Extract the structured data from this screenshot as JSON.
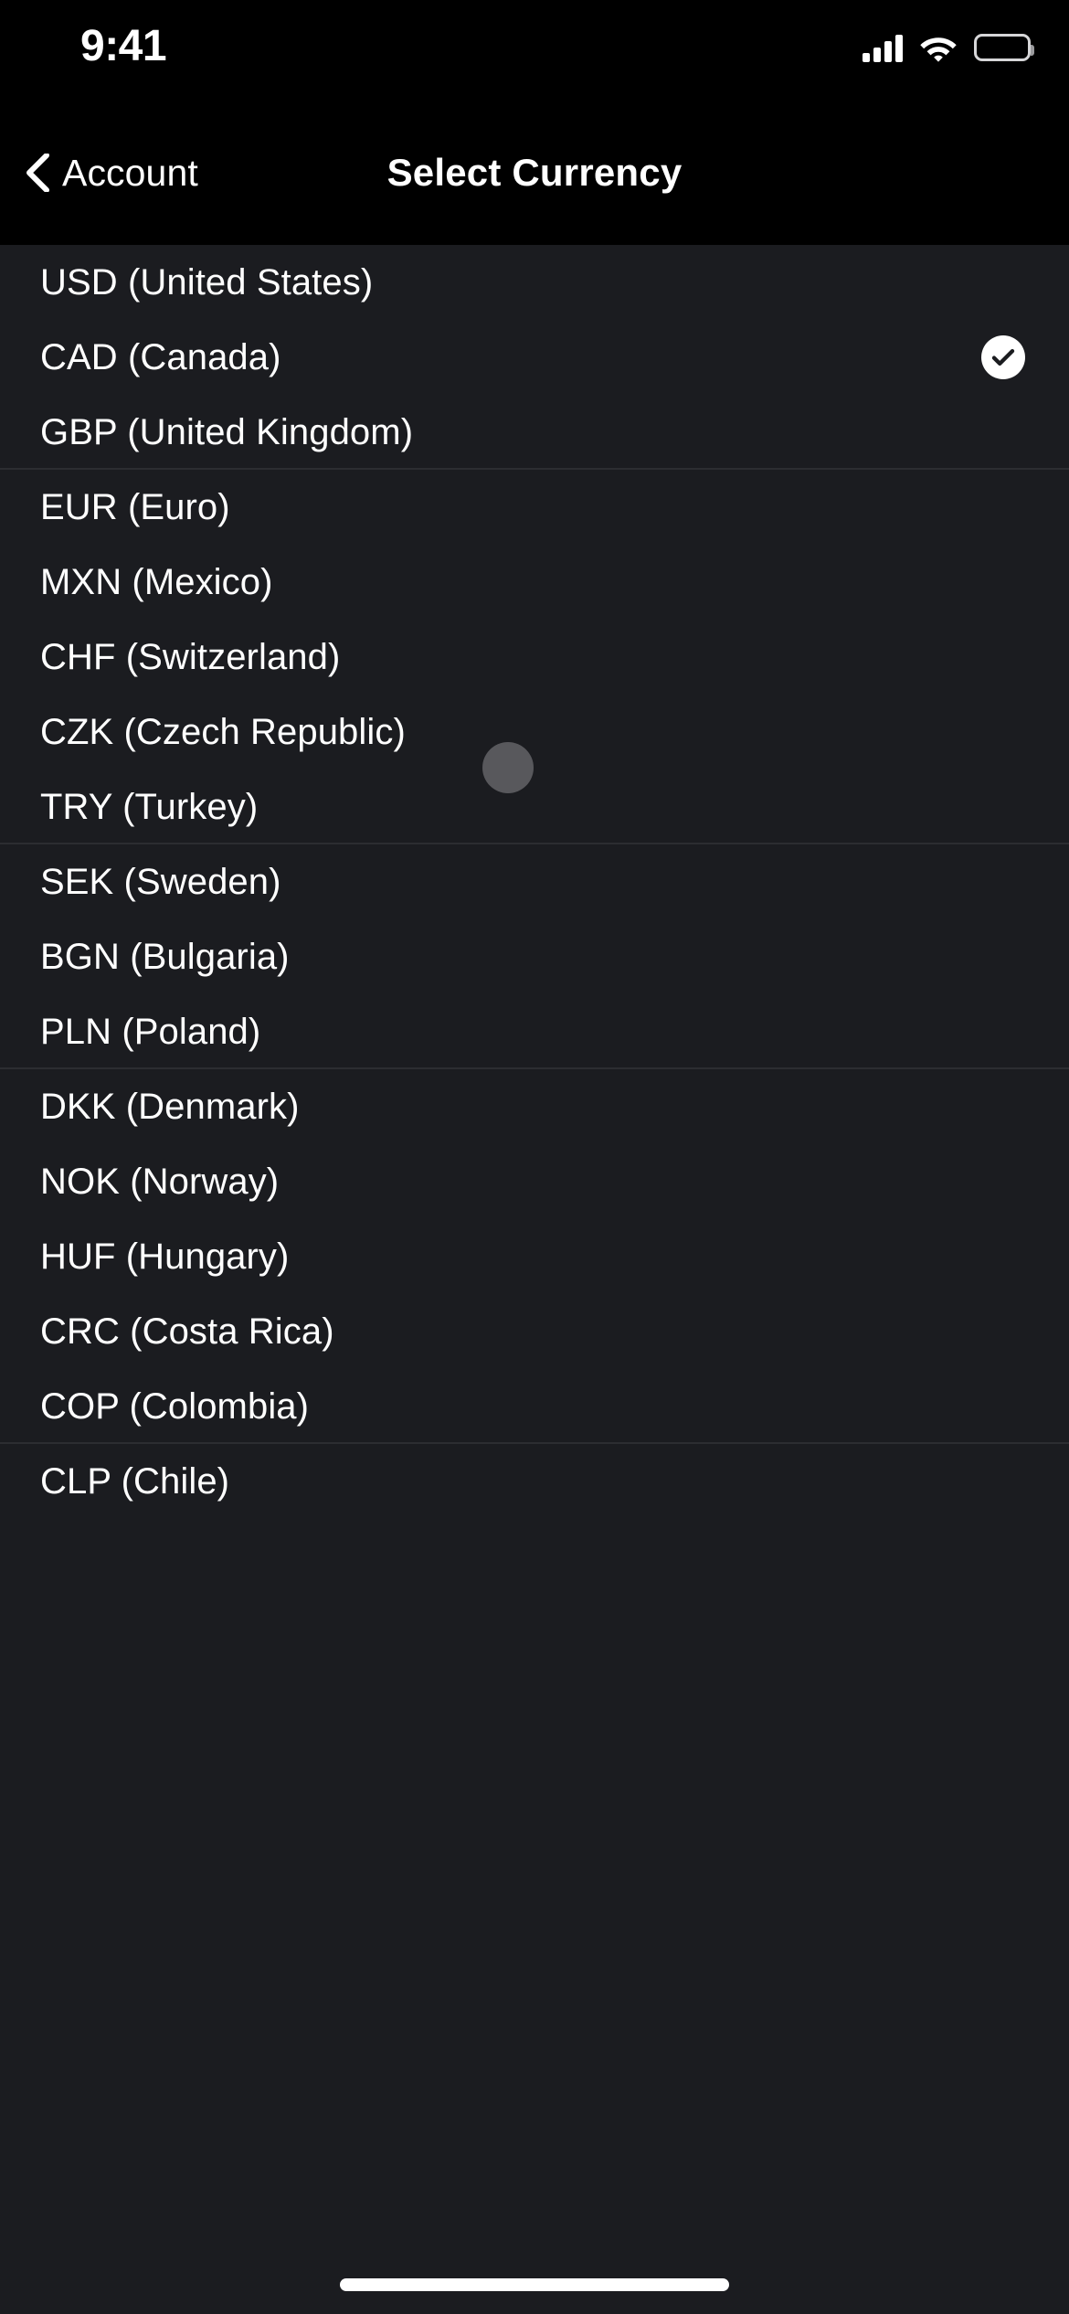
{
  "status_bar": {
    "time": "9:41",
    "cellular_icon": "cellular-signal-icon",
    "wifi_icon": "wifi-icon",
    "battery_icon": "battery-icon"
  },
  "nav_bar": {
    "back_label": "Account",
    "back_icon": "chevron-left-icon",
    "title": "Select Currency"
  },
  "colors": {
    "screen_background": "#000000",
    "list_background": "#1b1c20",
    "divider": "#2c2d31",
    "text_primary": "#ffffff",
    "check_badge_fill": "#ffffff",
    "check_mark": "#1b1c20",
    "touch_cursor": "#58585c"
  },
  "currency_list": {
    "selected_code": "CAD",
    "selected_icon": "check-circle-icon",
    "items": [
      {
        "label": "USD (United States)",
        "code": "USD",
        "selected": false,
        "divider_below": false
      },
      {
        "label": "CAD (Canada)",
        "code": "CAD",
        "selected": true,
        "divider_below": false
      },
      {
        "label": "GBP (United Kingdom)",
        "code": "GBP",
        "selected": false,
        "divider_below": true
      },
      {
        "label": "EUR (Euro)",
        "code": "EUR",
        "selected": false,
        "divider_below": false
      },
      {
        "label": "MXN (Mexico)",
        "code": "MXN",
        "selected": false,
        "divider_below": false
      },
      {
        "label": "CHF (Switzerland)",
        "code": "CHF",
        "selected": false,
        "divider_below": false
      },
      {
        "label": "CZK (Czech Republic)",
        "code": "CZK",
        "selected": false,
        "divider_below": false
      },
      {
        "label": "TRY (Turkey)",
        "code": "TRY",
        "selected": false,
        "divider_below": true
      },
      {
        "label": "SEK (Sweden)",
        "code": "SEK",
        "selected": false,
        "divider_below": false
      },
      {
        "label": "BGN (Bulgaria)",
        "code": "BGN",
        "selected": false,
        "divider_below": false
      },
      {
        "label": "PLN (Poland)",
        "code": "PLN",
        "selected": false,
        "divider_below": true
      },
      {
        "label": "DKK (Denmark)",
        "code": "DKK",
        "selected": false,
        "divider_below": false
      },
      {
        "label": "NOK (Norway)",
        "code": "NOK",
        "selected": false,
        "divider_below": false
      },
      {
        "label": "HUF (Hungary)",
        "code": "HUF",
        "selected": false,
        "divider_below": false
      },
      {
        "label": "CRC (Costa Rica)",
        "code": "CRC",
        "selected": false,
        "divider_below": false
      },
      {
        "label": "COP (Colombia)",
        "code": "COP",
        "selected": false,
        "divider_below": true
      },
      {
        "label": "CLP (Chile)",
        "code": "CLP",
        "selected": false,
        "divider_below": false
      }
    ]
  },
  "touch_cursor": {
    "name": "touch-cursor"
  },
  "home_indicator": {
    "name": "home-indicator"
  }
}
